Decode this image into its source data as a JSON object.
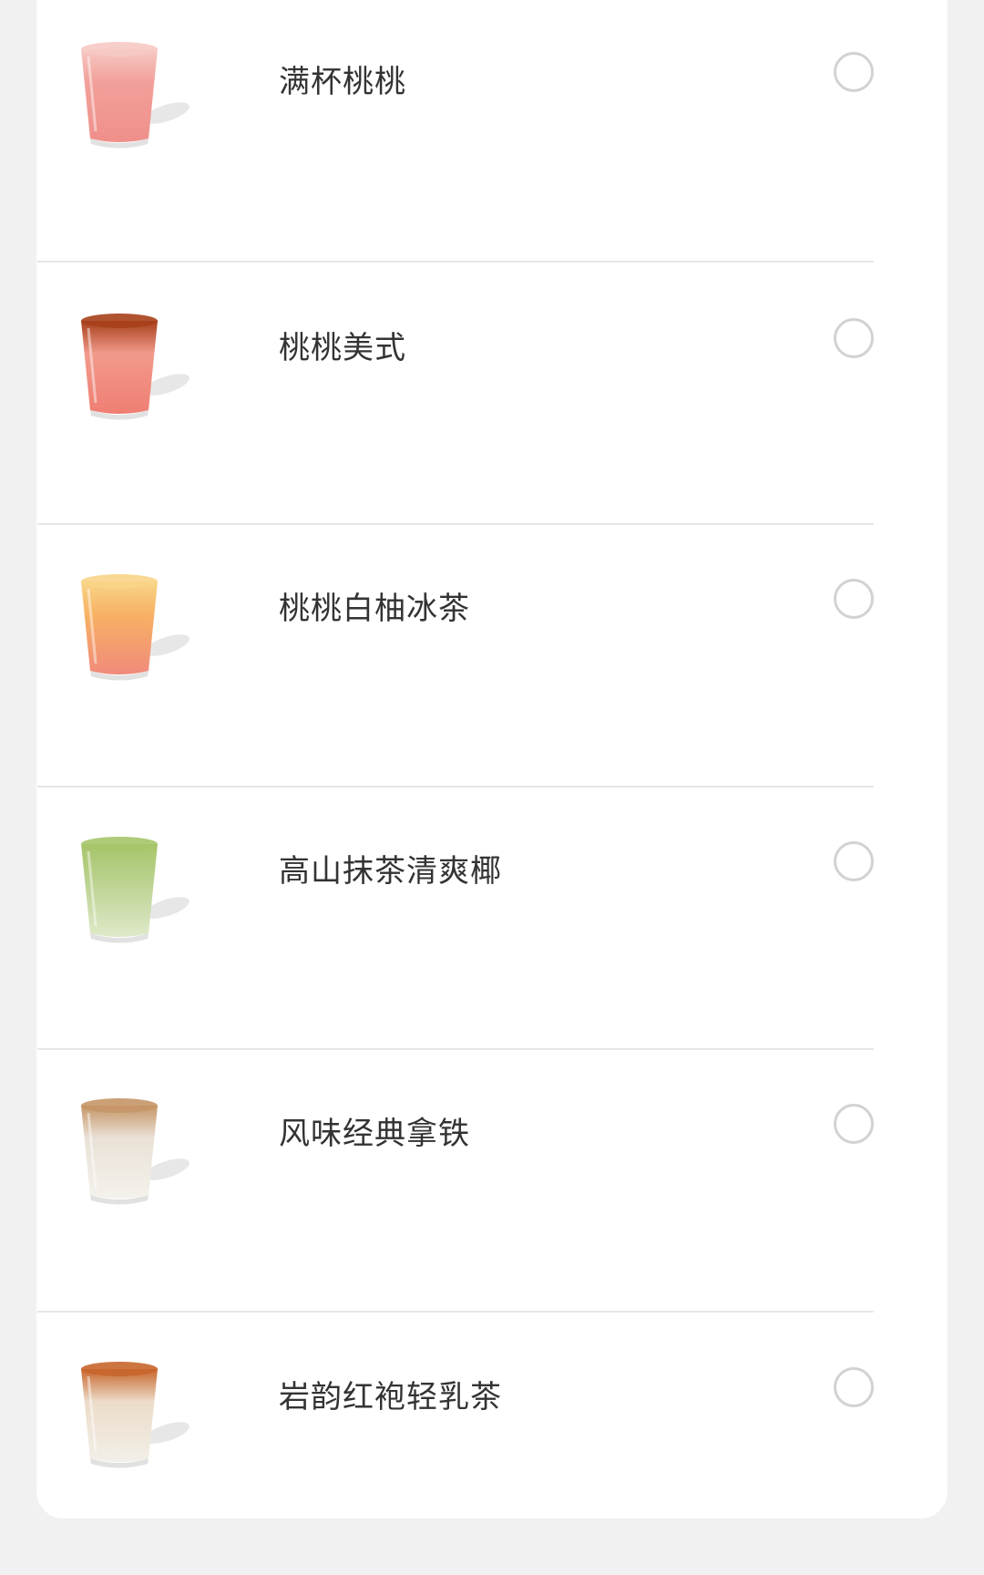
{
  "drinks": [
    {
      "name": "满杯桃桃",
      "icon": "peach-cup-icon",
      "colors": {
        "top": "#f6c9c4",
        "body": "#f2a09a",
        "base": "#f08f8a"
      }
    },
    {
      "name": "桃桃美式",
      "icon": "peach-americano-icon",
      "colors": {
        "top": "#a7401b",
        "body": "#f19a8b",
        "base": "#f07e73"
      }
    },
    {
      "name": "桃桃白柚冰茶",
      "icon": "peach-grapefruit-tea-icon",
      "colors": {
        "top": "#f8d487",
        "body": "#f7b264",
        "base": "#f08a7a"
      }
    },
    {
      "name": "高山抹茶清爽椰",
      "icon": "matcha-coconut-icon",
      "colors": {
        "top": "#a6c56a",
        "body": "#b8d08a",
        "base": "#dfe9c9"
      }
    },
    {
      "name": "风味经典拿铁",
      "icon": "classic-latte-icon",
      "colors": {
        "top": "#c59667",
        "body": "#e9e1d6",
        "base": "#f4f2ec"
      }
    },
    {
      "name": "岩韵红袍轻乳茶",
      "icon": "oolong-milk-tea-icon",
      "colors": {
        "top": "#c8662c",
        "body": "#ecdcc9",
        "base": "#f2efe8"
      }
    }
  ],
  "selected": null
}
